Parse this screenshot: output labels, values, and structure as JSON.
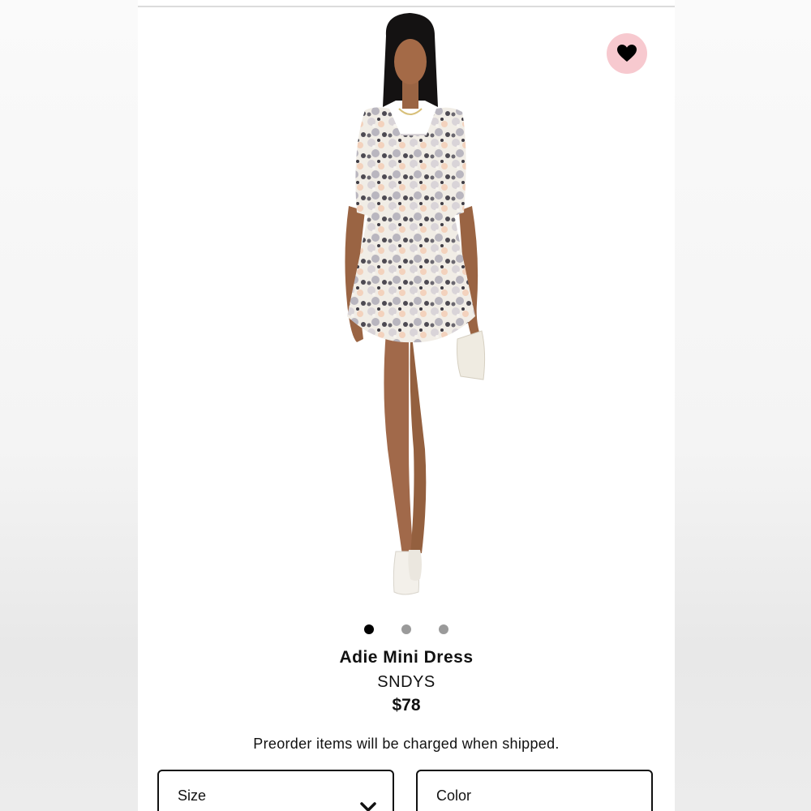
{
  "product": {
    "name": "Adie Mini Dress",
    "brand": "SNDYS",
    "price": "$78",
    "image_alt": "Model wearing Adie Mini Dress"
  },
  "gallery": {
    "dot_count": 3,
    "active_index": 0
  },
  "wishlist": {
    "icon": "heart-icon",
    "active": true,
    "bg_color": "#f7c9cf"
  },
  "notice": "Preorder items will be charged when shipped.",
  "selectors": {
    "size_label": "Size",
    "color_label": "Color"
  },
  "icons": {
    "dropdown": "chevron-down-icon"
  }
}
